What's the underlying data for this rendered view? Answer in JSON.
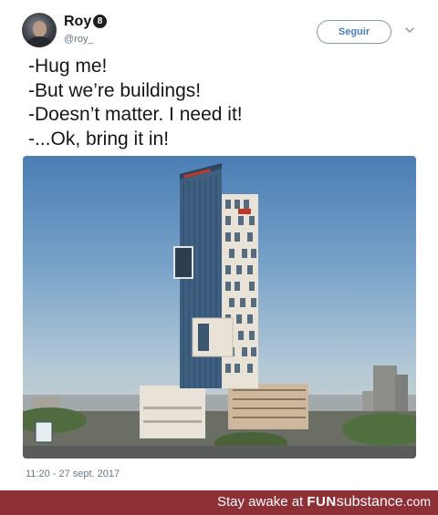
{
  "tweet": {
    "author": {
      "name": "Roy",
      "badge": "8",
      "handle": "@roy_"
    },
    "follow_label": "Seguir",
    "lines": [
      "-Hug me!",
      "-But we’re buildings!",
      "-Doesn’t matter. I need it!",
      "-...Ok, bring it in!"
    ],
    "timestamp": "11:20 - 27 sept. 2017",
    "icons": {
      "more": "chevron-down-icon",
      "badge": "number-badge-icon"
    },
    "colors": {
      "follow_text": "#4a7ebf",
      "handle": "#657786"
    }
  },
  "watermark": {
    "prefix": "Stay awake at ",
    "brand_a": "FUN",
    "brand_b": "substance",
    "brand_c": ".com",
    "bar_color": "#8f2f36"
  }
}
